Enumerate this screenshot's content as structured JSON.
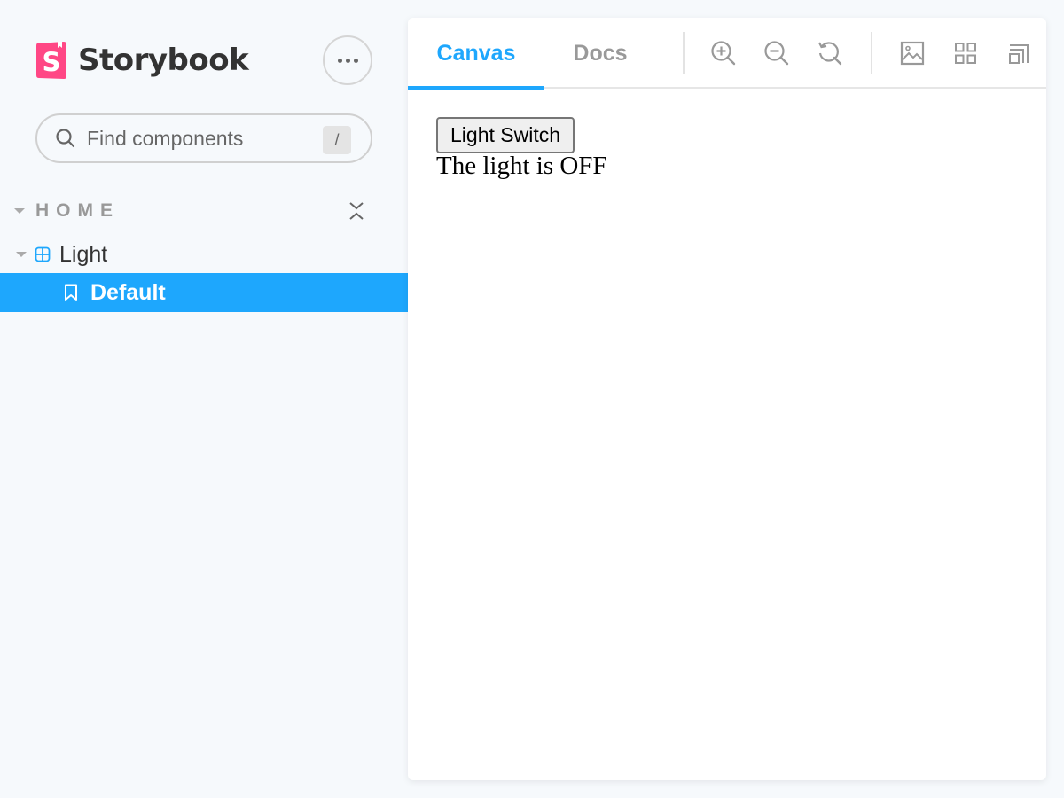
{
  "sidebar": {
    "brand": {
      "name": "Storybook",
      "logo_letter": "S",
      "logo_color": "#ff4785"
    },
    "menu_button_icon": "ellipsis-icon",
    "search": {
      "placeholder": "Find components",
      "value": "",
      "shortcut": "/"
    },
    "section": {
      "label": "HOME",
      "collapse_icon": "collapse-all-icon"
    },
    "tree": [
      {
        "label": "Light",
        "type": "component",
        "icon": "component-icon",
        "expanded": true
      },
      {
        "label": "Default",
        "type": "story",
        "icon": "bookmark-icon",
        "selected": true
      }
    ]
  },
  "panel": {
    "tabs": [
      {
        "label": "Canvas",
        "active": true
      },
      {
        "label": "Docs",
        "active": false
      }
    ],
    "tools": [
      {
        "name": "zoom-in",
        "icon": "zoom-in-icon"
      },
      {
        "name": "zoom-out",
        "icon": "zoom-out-icon"
      },
      {
        "name": "zoom-reset",
        "icon": "zoom-reset-icon"
      },
      {
        "name": "background",
        "icon": "image-icon"
      },
      {
        "name": "grid",
        "icon": "grid-icon"
      },
      {
        "name": "viewport",
        "icon": "viewport-icon"
      }
    ],
    "preview": {
      "button_label": "Light Switch",
      "status_text": "The light is OFF"
    }
  },
  "colors": {
    "accent": "#1ea7fd",
    "background": "#f6f9fc",
    "brand": "#ff4785"
  }
}
